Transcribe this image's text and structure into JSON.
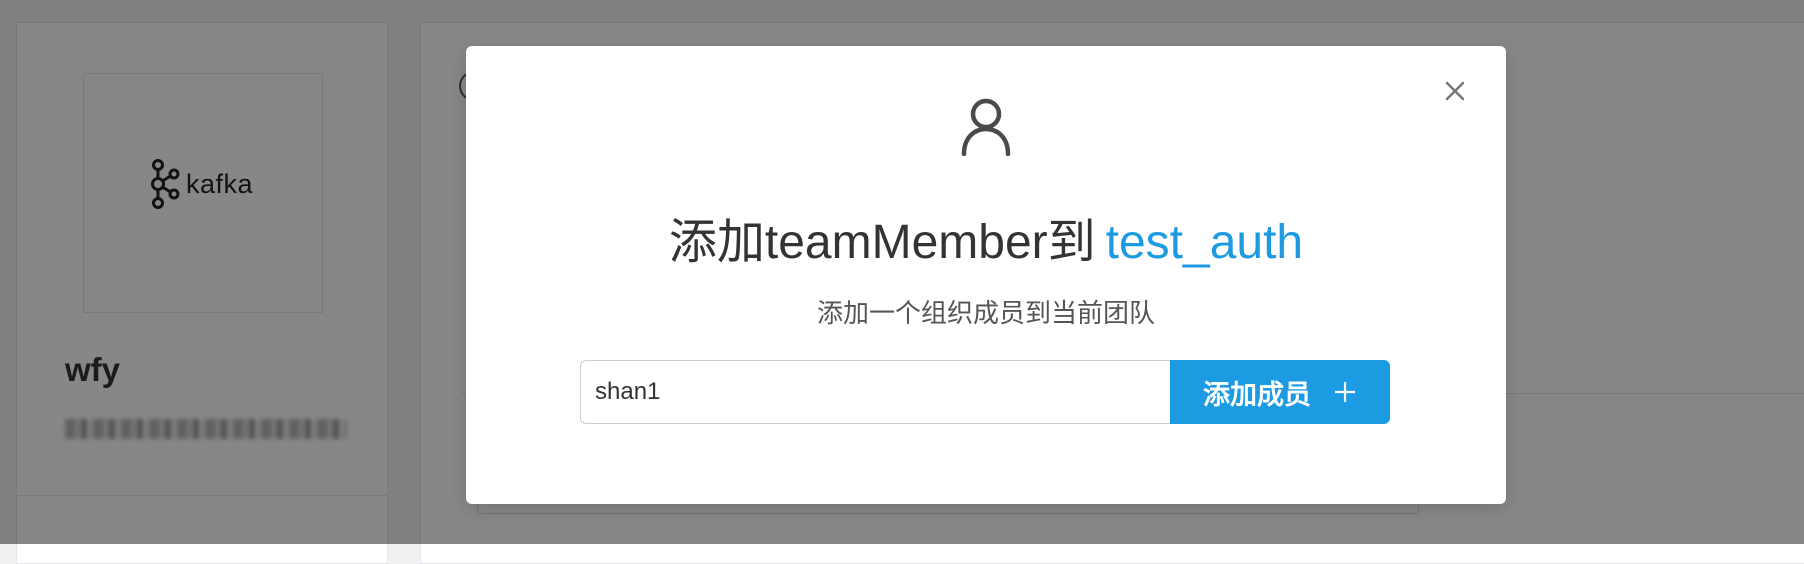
{
  "background": {
    "logo_text": "kafka",
    "org_name": "wfy"
  },
  "modal": {
    "title_prefix": "添加teamMember到",
    "team_name": "test_auth",
    "subtitle": "添加一个组织成员到当前团队",
    "input_value": "shan1",
    "add_button_label": "添加成员",
    "icons": {
      "close": "close-icon",
      "user": "user-icon",
      "plus": "plus-icon"
    }
  },
  "colors": {
    "accent": "#1c9be3",
    "overlay": "rgba(0,0,0,0.47)"
  }
}
